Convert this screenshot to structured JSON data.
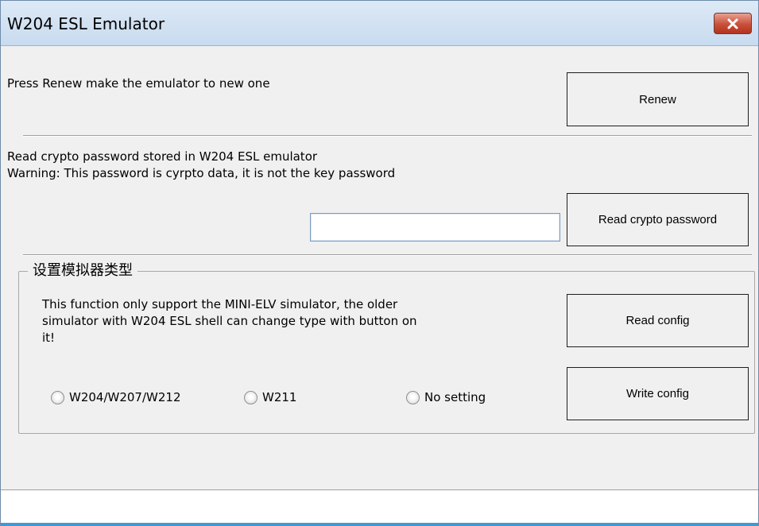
{
  "window": {
    "title": "W204 ESL Emulator"
  },
  "renew_section": {
    "description": "Press Renew make the emulator to new one",
    "button_label": "Renew"
  },
  "crypto_section": {
    "line1": "Read crypto password stored in W204 ESL emulator",
    "line2": "Warning: This password is cyrpto data, it is not the key password",
    "password_value": "",
    "button_label": "Read crypto password"
  },
  "config_group": {
    "title": "设置模拟器类型",
    "line1": "This function only support the MINI-ELV simulator, the older",
    "line2": "simulator with W204 ESL shell can change type with button on",
    "line3": "it!",
    "read_button_label": "Read config",
    "write_button_label": "Write config",
    "options": [
      {
        "label": "W204/W207/W212",
        "selected": false
      },
      {
        "label": "W211",
        "selected": false
      },
      {
        "label": "No setting",
        "selected": false
      }
    ]
  },
  "status_bar": {
    "text": ""
  }
}
